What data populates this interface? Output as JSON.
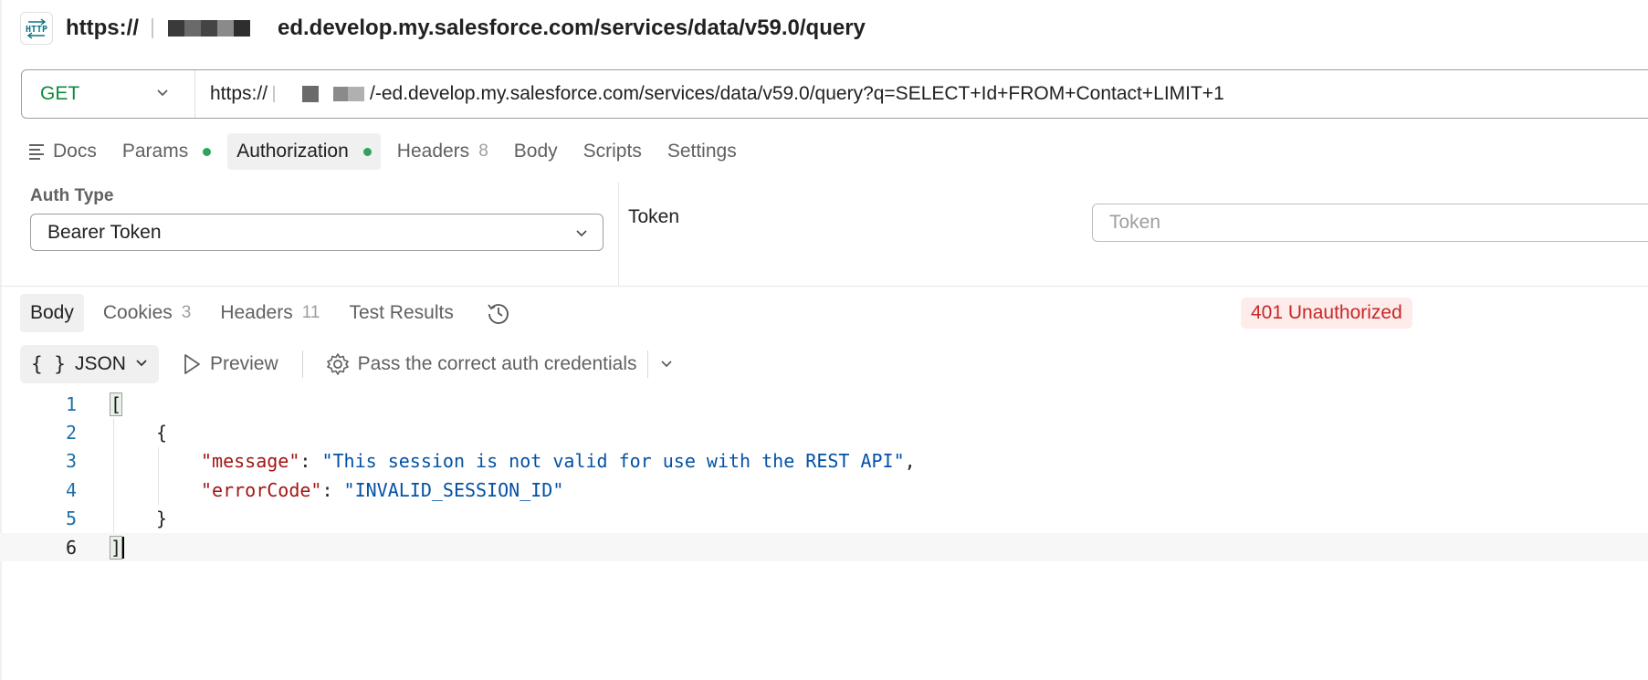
{
  "title": {
    "prefix": "https://",
    "suffix": "ed.develop.my.salesforce.com/services/data/v59.0/query",
    "icon": "http-icon"
  },
  "request": {
    "method": "GET",
    "url_prefix": "https://",
    "url_suffix": "/-ed.develop.my.salesforce.com/services/data/v59.0/query?q=SELECT+Id+FROM+Contact+LIMIT+1"
  },
  "request_tabs": {
    "docs": "Docs",
    "params": "Params",
    "authorization": "Authorization",
    "headers": "Headers",
    "headers_count": "8",
    "body": "Body",
    "scripts": "Scripts",
    "settings": "Settings"
  },
  "auth": {
    "type_label": "Auth Type",
    "type_value": "Bearer Token",
    "token_label": "Token",
    "token_placeholder": "Token"
  },
  "response_tabs": {
    "body": "Body",
    "cookies": "Cookies",
    "cookies_count": "3",
    "headers": "Headers",
    "headers_count": "11",
    "test_results": "Test Results"
  },
  "status": {
    "text": "401 Unauthorized",
    "color": "#c62828"
  },
  "response_toolbar": {
    "format": "JSON",
    "preview": "Preview",
    "hint": "Pass the correct auth credentials"
  },
  "code": {
    "line_numbers": [
      "1",
      "2",
      "3",
      "4",
      "5",
      "6"
    ],
    "open_bracket": "[",
    "open_brace": "{",
    "key1": "\"message\"",
    "value1": "\"This session is not valid for use with the REST API\"",
    "key2": "\"errorCode\"",
    "value2": "\"INVALID_SESSION_ID\"",
    "close_brace": "}",
    "close_bracket": "]"
  },
  "colors": {
    "method_green": "#0f8a3f",
    "dot_green": "#2fa45a",
    "json_key": "#a31515",
    "json_string": "#0451a5"
  }
}
